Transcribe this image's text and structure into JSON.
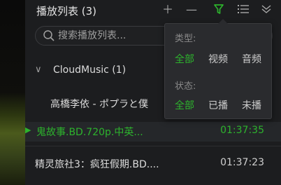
{
  "header": {
    "title": "播放列表 (3)",
    "add_icon": "plus-icon",
    "remove_icon": "minus-icon",
    "filter_icon": "filter-icon",
    "menu_icon": "list-menu-icon",
    "collapse_icon": "chevron-down-icon"
  },
  "search": {
    "placeholder": "搜索播放列表..."
  },
  "folder": {
    "name": "CloudMusic (1)",
    "icon": "chevron-down-icon"
  },
  "rows": [
    {
      "name": "高橋李依 - ポプラと僕",
      "duration": ""
    },
    {
      "name": "鬼故事.BD.720p.中英...",
      "duration": "01:37:35",
      "active": true
    },
    {
      "name": "精灵旅社3：疯狂假期.BD....",
      "duration": "01:37:23"
    }
  ],
  "filter_popup": {
    "type_label": "类型:",
    "type_options": [
      "全部",
      "视频",
      "音频"
    ],
    "type_selected": "全部",
    "status_label": "状态:",
    "status_options": [
      "全部",
      "已播",
      "未播"
    ],
    "status_selected": "全部"
  },
  "colors": {
    "accent": "#2db32d",
    "panel_bg": "#1c1d1f",
    "popup_bg": "#2a2b2e"
  }
}
